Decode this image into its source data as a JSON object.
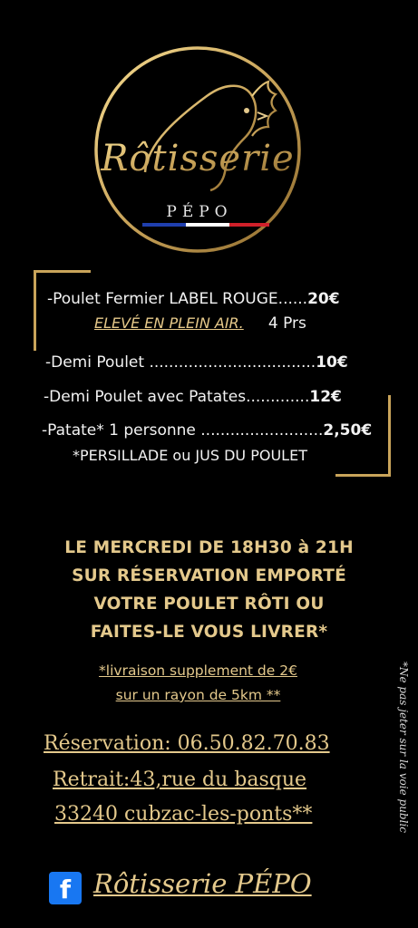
{
  "brand": {
    "name": "Rôtisserie",
    "subtitle": "PÉPO",
    "colors": {
      "gold": "#c9a45a",
      "blue": "#1f3fae",
      "red": "#d0202a"
    }
  },
  "menu": {
    "item1": {
      "label": "-Poulet Fermier LABEL ROUGE......",
      "price": "20€"
    },
    "item1_note": {
      "label": "ELEVÉ EN PLEIN AIR.",
      "portion": "4 Prs"
    },
    "item2": {
      "label": "-Demi Poulet ..................................",
      "price": "10€"
    },
    "item3": {
      "label": "-Demi Poulet avec Patates.............",
      "price": "12€"
    },
    "item4": {
      "label": "-Patate* 1 personne .........................",
      "price": "2,50€"
    },
    "item4_note": "*PERSILLADE ou JUS DU POULET"
  },
  "promo": {
    "line1": "LE MERCREDI DE 18H30 à 21H",
    "line2": "SUR RÉSERVATION EMPORTÉ",
    "line3": "VOTRE POULET RÔTI OU",
    "line4": "FAITES-LE VOUS LIVRER*",
    "delivery1": "*livraison  supplement de 2€",
    "delivery2": "sur un rayon de  5km **"
  },
  "contact": {
    "reservation": "Réservation: 06.50.82.70.83",
    "address1": "Retrait:43,rue du basque ",
    "address2": "33240 cubzac-les-ponts**"
  },
  "side_note": "*Ne pas jeter sur la voie public",
  "social": {
    "icon": "facebook-icon",
    "letter": "f",
    "name": "Rôtisserie PÉPO"
  }
}
